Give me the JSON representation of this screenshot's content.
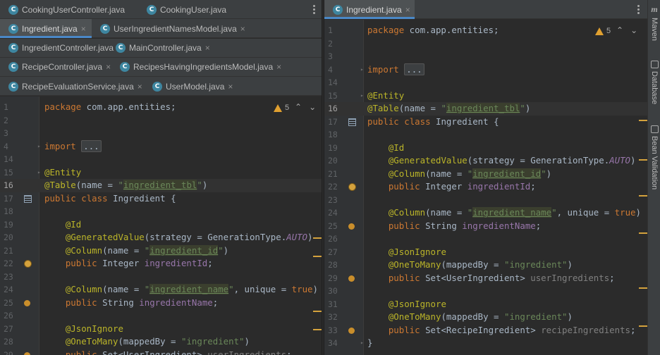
{
  "left_tabs": [
    [
      {
        "label": "CookingUserController.java",
        "active": false,
        "closable": false
      },
      {
        "label": "CookingUser.java",
        "active": false,
        "closable": false
      }
    ],
    [
      {
        "label": "Ingredient.java",
        "active": true,
        "closable": true
      },
      {
        "label": "UserIngredientNamesModel.java",
        "active": false,
        "closable": true
      }
    ],
    [
      {
        "label": "IngredientController.java",
        "active": false,
        "closable": false
      },
      {
        "label": "MainController.java",
        "active": false,
        "closable": true
      }
    ],
    [
      {
        "label": "RecipeController.java",
        "active": false,
        "closable": true
      },
      {
        "label": "RecipesHavingIngredientsModel.java",
        "active": false,
        "closable": true
      }
    ],
    [
      {
        "label": "RecipeEvaluationService.java",
        "active": false,
        "closable": true
      },
      {
        "label": "UserModel.java",
        "active": false,
        "closable": true
      }
    ]
  ],
  "right_tabs": [
    {
      "label": "Ingredient.java",
      "active": true,
      "closable": true
    }
  ],
  "tab_icon_letter": "C",
  "close_glyph": "×",
  "inspections": {
    "warning_count": "5",
    "up_arrow": "⌃",
    "down_arrow": "⌄"
  },
  "left_editor": {
    "current_line": "16",
    "lines": [
      {
        "num": "1",
        "code": "package com.app.entities;"
      },
      {
        "num": "2",
        "code": ""
      },
      {
        "num": "3",
        "code": ""
      },
      {
        "num": "4",
        "code": "import ..."
      },
      {
        "num": "14",
        "code": ""
      },
      {
        "num": "15",
        "code": "@Entity"
      },
      {
        "num": "16",
        "code": "@Table(name = \"ingredient_tbl\")"
      },
      {
        "num": "17",
        "code": "public class Ingredient {"
      },
      {
        "num": "18",
        "code": ""
      },
      {
        "num": "19",
        "code": "    @Id"
      },
      {
        "num": "20",
        "code": "    @GeneratedValue(strategy = GenerationType.AUTO)"
      },
      {
        "num": "21",
        "code": "    @Column(name = \"ingredient_id\")"
      },
      {
        "num": "22",
        "code": "    public Integer ingredientId;"
      },
      {
        "num": "23",
        "code": ""
      },
      {
        "num": "24",
        "code": "    @Column(name = \"ingredient_name\", unique = true)"
      },
      {
        "num": "25",
        "code": "    public String ingredientName;"
      },
      {
        "num": "26",
        "code": ""
      },
      {
        "num": "27",
        "code": "    @JsonIgnore"
      },
      {
        "num": "28",
        "code": "    @OneToMany(mappedBy = \"ingredient\")"
      },
      {
        "num": "29",
        "code": "    public Set<UserIngredient> userIngredients;"
      }
    ]
  },
  "right_editor": {
    "current_line": "16",
    "lines": [
      {
        "num": "1",
        "code": "package com.app.entities;"
      },
      {
        "num": "2",
        "code": ""
      },
      {
        "num": "3",
        "code": ""
      },
      {
        "num": "4",
        "code": "import ..."
      },
      {
        "num": "14",
        "code": ""
      },
      {
        "num": "15",
        "code": "@Entity"
      },
      {
        "num": "16",
        "code": "@Table(name = \"ingredient_tbl\")"
      },
      {
        "num": "17",
        "code": "public class Ingredient {"
      },
      {
        "num": "18",
        "code": ""
      },
      {
        "num": "19",
        "code": "    @Id"
      },
      {
        "num": "20",
        "code": "    @GeneratedValue(strategy = GenerationType.AUTO)"
      },
      {
        "num": "21",
        "code": "    @Column(name = \"ingredient_id\")"
      },
      {
        "num": "22",
        "code": "    public Integer ingredientId;"
      },
      {
        "num": "23",
        "code": ""
      },
      {
        "num": "24",
        "code": "    @Column(name = \"ingredient_name\", unique = true)"
      },
      {
        "num": "25",
        "code": "    public String ingredientName;"
      },
      {
        "num": "26",
        "code": ""
      },
      {
        "num": "27",
        "code": "    @JsonIgnore"
      },
      {
        "num": "28",
        "code": "    @OneToMany(mappedBy = \"ingredient\")"
      },
      {
        "num": "29",
        "code": "    public Set<UserIngredient> userIngredients;"
      },
      {
        "num": "30",
        "code": ""
      },
      {
        "num": "31",
        "code": "    @JsonIgnore"
      },
      {
        "num": "32",
        "code": "    @OneToMany(mappedBy = \"ingredient\")"
      },
      {
        "num": "33",
        "code": "    public Set<RecipeIngredient> recipeIngredients;"
      },
      {
        "num": "34",
        "code": "}"
      }
    ]
  },
  "tool_windows": {
    "maven_icon": "m",
    "maven": "Maven",
    "database": "Database",
    "bean_validation": "Bean Validation"
  },
  "colors": {
    "keyword": "#cc7832",
    "annotation": "#bbb529",
    "string": "#6a8759",
    "static_field": "#9876aa",
    "default_text": "#a9b7c6",
    "warning": "#e0a030",
    "tab_accent": "#4a88c7"
  }
}
